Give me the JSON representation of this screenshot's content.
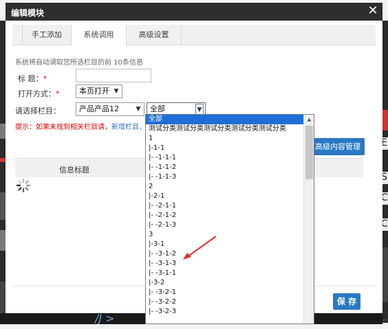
{
  "dialog": {
    "title": "编辑模块",
    "close_icon": "close-icon",
    "close_glyph": "✕"
  },
  "tabs": [
    {
      "label": "手工添加",
      "active": false
    },
    {
      "label": "系统调用",
      "active": true
    },
    {
      "label": "高级设置",
      "active": false
    }
  ],
  "info": "系统将自动调取您所选栏目的前 10条信息",
  "form": {
    "title_label": "标 题：",
    "title_required": "*",
    "title_value": "",
    "open_label": "打开方式：",
    "open_required": "*",
    "open_value": "本页打开",
    "column_label": "请选择栏目：",
    "column_value": "产品产品12",
    "subcolumn_value": "全部"
  },
  "hint": {
    "text": "提示：如果未找到相关栏目请，",
    "link": "新增栏目、"
  },
  "advanced_button": "高级内容管理",
  "table": {
    "header": "信息标题"
  },
  "dropdown": {
    "items": [
      "全部",
      "测试分类测试分类测试分类测试分类测试分类",
      "1",
      " |-1-1",
      " |- -1-1-1",
      " |- -1-1-2",
      " |- -1-1-3",
      "2",
      " |-2-1",
      " |- -2-1-1",
      " |- -2-1-2",
      " |- -2-1-3",
      "3",
      " |-3-1",
      " |- -3-1-2",
      " |- -3-1-3",
      " |- -3-1-1",
      " |-3-2",
      " |- -3-2-1",
      " |- -3-2-2",
      " |- -3-2-3"
    ],
    "selected_index": 0
  },
  "save_button": "保 存",
  "background": {
    "right_chars": [
      "E",
      "S",
      "C",
      "C"
    ],
    "bottom_text": "/J >",
    "trailing_mark": "↵"
  },
  "colors": {
    "title_bar": "#2e2e2e",
    "accent_blue": "#2a79c4",
    "required_red": "#e60000",
    "selection_blue": "#1e6fd9",
    "annotation_red": "#e53030"
  }
}
